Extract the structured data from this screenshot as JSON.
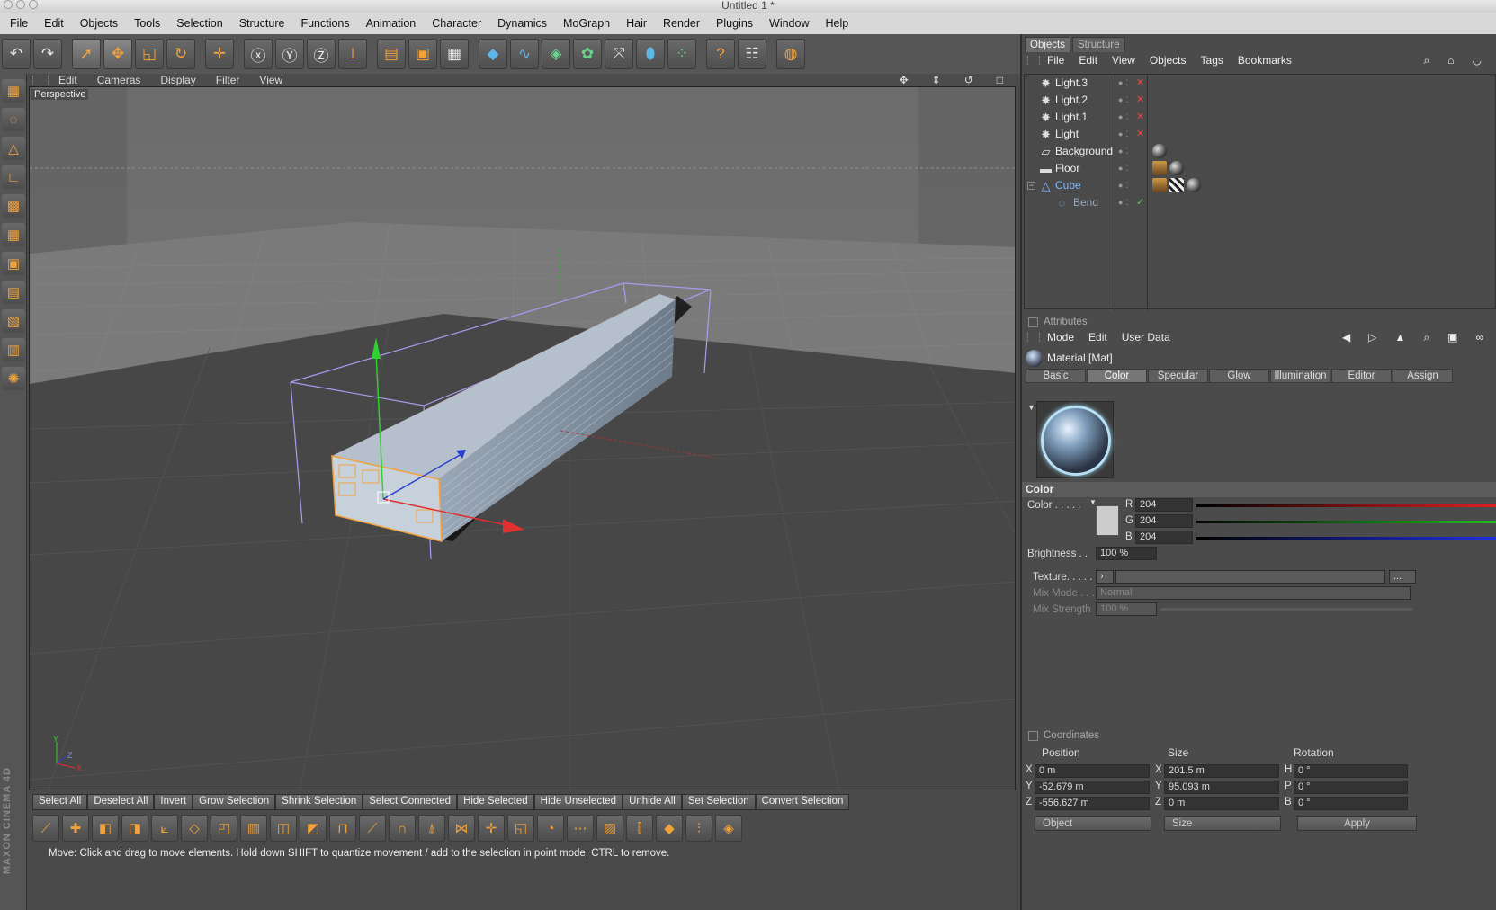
{
  "window": {
    "title": "Untitled 1 *"
  },
  "menubar": [
    "File",
    "Edit",
    "Objects",
    "Tools",
    "Selection",
    "Structure",
    "Functions",
    "Animation",
    "Character",
    "Dynamics",
    "MoGraph",
    "Hair",
    "Render",
    "Plugins",
    "Window",
    "Help"
  ],
  "viewport": {
    "menu": [
      "Edit",
      "Cameras",
      "Display",
      "Filter",
      "View"
    ],
    "label": "Perspective"
  },
  "selection_bar": [
    "Select All",
    "Deselect All",
    "Invert",
    "Grow Selection",
    "Shrink Selection",
    "Select Connected",
    "Hide Selected",
    "Hide Unselected",
    "Unhide All",
    "Set Selection",
    "Convert Selection"
  ],
  "status": "Move: Click and drag to move elements. Hold down SHIFT to quantize movement / add to the selection in point mode, CTRL to remove.",
  "brand": "MAXON CINEMA 4D",
  "objects_panel": {
    "tabs": [
      "Objects",
      "Structure"
    ],
    "menu": [
      "File",
      "Edit",
      "View",
      "Objects",
      "Tags",
      "Bookmarks"
    ],
    "items": [
      {
        "name": "Light.3",
        "icon": "light-icon"
      },
      {
        "name": "Light.2",
        "icon": "light-icon"
      },
      {
        "name": "Light.1",
        "icon": "light-icon"
      },
      {
        "name": "Light",
        "icon": "light-icon"
      },
      {
        "name": "Background",
        "icon": "background-icon"
      },
      {
        "name": "Floor",
        "icon": "floor-icon"
      },
      {
        "name": "Cube",
        "icon": "cube-icon"
      },
      {
        "name": "Bend",
        "icon": "bend-icon"
      }
    ]
  },
  "attributes": {
    "header": "Attributes",
    "menu": [
      "Mode",
      "Edit",
      "User Data"
    ],
    "material_title": "Material [Mat]",
    "tabs": [
      "Basic",
      "Color",
      "Specular",
      "Glow",
      "Illumination",
      "Editor",
      "Assign"
    ],
    "active_tab": "Color",
    "section": "Color",
    "color_label": "Color . . . . .",
    "r_label": "R",
    "g_label": "G",
    "b_label": "B",
    "r": "204",
    "g": "204",
    "b": "204",
    "brightness_label": "Brightness . .",
    "brightness": "100 %",
    "texture_label": "Texture. . . . .",
    "texture_more": "...",
    "mix_mode_label": "Mix Mode . . .",
    "mix_mode": "Normal",
    "mix_strength_label": "Mix Strength",
    "mix_strength": "100 %",
    "swatch_color": "#cccccc"
  },
  "coordinates": {
    "header": "Coordinates",
    "position_label": "Position",
    "size_label": "Size",
    "rotation_label": "Rotation",
    "position": {
      "x": "0 m",
      "y": "-52.679 m",
      "z": "-556.627 m"
    },
    "size": {
      "x": "201.5 m",
      "y": "95.093 m",
      "z": "0 m"
    },
    "rotation": {
      "h": "0 °",
      "p": "0 °",
      "b": "0 °"
    },
    "axis_labels": {
      "x": "X",
      "y": "Y",
      "z": "Z",
      "h": "H",
      "p": "P",
      "b": "B"
    },
    "mode_object": "Object",
    "mode_size": "Size",
    "apply_label": "Apply"
  },
  "colors": {
    "accent_orange": "#f2a23a",
    "selection_blue": "#7fb6ff",
    "background_panel": "#4b4b4b"
  }
}
